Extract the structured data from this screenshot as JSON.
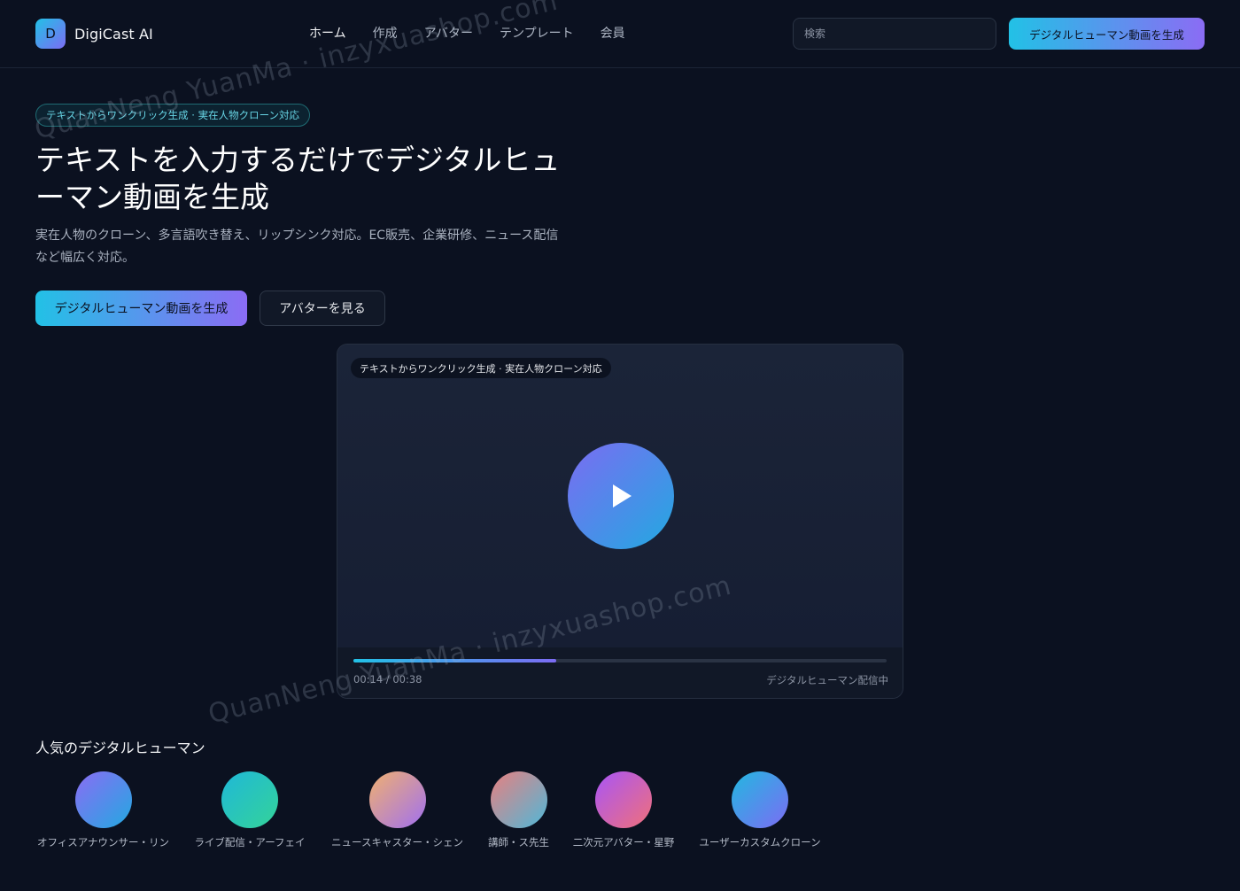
{
  "brand": {
    "logo_letter": "D",
    "name": "DigiCast AI"
  },
  "nav": [
    "ホーム",
    "作成",
    "アバター",
    "テンプレート",
    "会員"
  ],
  "header": {
    "search_placeholder": "検索",
    "cta_label": "デジタルヒューマン動画を生成"
  },
  "hero": {
    "badge": "テキストからワンクリック生成 · 実在人物クローン対応",
    "title": "テキストを入力するだけでデジタルヒューマン動画を生成",
    "description": "実在人物のクローン、多言語吹き替え、リップシンク対応。EC販売、企業研修、ニュース配信など幅広く対応。",
    "primary_button": "デジタルヒューマン動画を生成",
    "secondary_button": "アバターを見る"
  },
  "player": {
    "tag": "テキストからワンクリック生成 · 実在人物クローン対応",
    "progress": 0.38,
    "time": "00:14 / 00:38",
    "status": "デジタルヒューマン配信中"
  },
  "popular": {
    "title": "人気のデジタルヒューマン",
    "avatars": [
      {
        "name": "オフィスアナウンサー・リン",
        "gradient": [
          "#8b6cf4",
          "#22a9e1"
        ]
      },
      {
        "name": "ライブ配信・アーフェイ",
        "gradient": [
          "#1fb8d8",
          "#34d399"
        ]
      },
      {
        "name": "ニュースキャスター・シェン",
        "gradient": [
          "#f0b070",
          "#a070f0"
        ]
      },
      {
        "name": "講師・ス先生",
        "gradient": [
          "#e88080",
          "#4fb8d8"
        ]
      },
      {
        "name": "二次元アバター・星野",
        "gradient": [
          "#a855f7",
          "#f0707a"
        ]
      },
      {
        "name": "ユーザーカスタムクローン",
        "gradient": [
          "#22b8e0",
          "#7c6cf4"
        ]
      }
    ]
  },
  "watermark": "QuanNeng YuanMa · inzyxuashop.com",
  "colors": {
    "background": "#0b1120",
    "accent_start": "#22c1e6",
    "accent_end": "#8b6cf4"
  }
}
